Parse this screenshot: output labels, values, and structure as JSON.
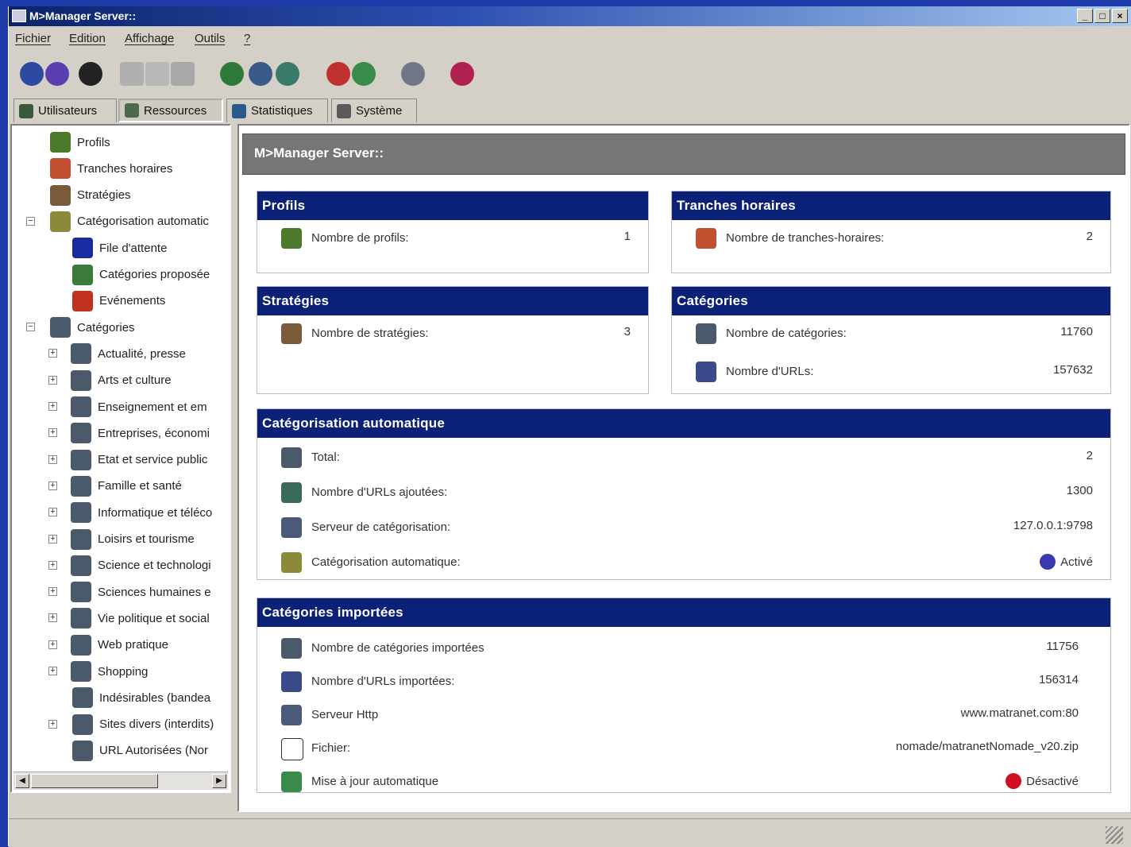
{
  "window": {
    "title": "M>Manager Server::",
    "controls": [
      "_",
      "□",
      "×"
    ]
  },
  "menu": [
    "Fichier",
    "Edition",
    "Affichage",
    "Outils",
    "?"
  ],
  "toolbar": {
    "icons": [
      "new-icon",
      "connect-icon",
      "delete-icon",
      "cut-icon",
      "copy-icon",
      "paste-icon",
      "import-icon",
      "export-icon",
      "refresh-icon",
      "calendar-icon",
      "sync-icon",
      "server-icon",
      "help-book-icon"
    ],
    "colors": [
      "#2b4aa0",
      "#5a3fb0",
      "#222222",
      "#b0b0b0",
      "#b8b8b8",
      "#a8a8a8",
      "#2f7a3a",
      "#3a5a8a",
      "#3a7a6a",
      "#c03030",
      "#3a8a4a",
      "#707888",
      "#b02050"
    ]
  },
  "tabs": [
    "Utilisateurs",
    "Ressources",
    "Statistiques",
    "Système"
  ],
  "tree": [
    {
      "label": "Profils",
      "icon": "user-icon",
      "color": "#4a7a2a"
    },
    {
      "label": "Tranches horaires",
      "icon": "clock-icon",
      "color": "#c05030"
    },
    {
      "label": "Stratégies",
      "icon": "strategy-icon",
      "color": "#7a5a3a"
    },
    {
      "label": "Catégorisation automatic",
      "icon": "gears-icon",
      "color": "#8a8a3a"
    },
    {
      "label": "File d'attente",
      "icon": "question-icon",
      "color": "#1a2aa0"
    },
    {
      "label": "Catégories proposée",
      "icon": "proposal-icon",
      "color": "#3a7a3a"
    },
    {
      "label": "Evénements",
      "icon": "warning-icon",
      "color": "#c03020"
    },
    {
      "label": "Catégories",
      "icon": "folder-stack-icon",
      "color": "#4a5a6a"
    },
    {
      "label": "Actualité, presse",
      "icon": "category-icon",
      "color": "#4a5a6a"
    },
    {
      "label": "Arts et culture",
      "icon": "category-icon",
      "color": "#4a5a6a"
    },
    {
      "label": "Enseignement et em",
      "icon": "category-icon",
      "color": "#4a5a6a"
    },
    {
      "label": "Entreprises, économi",
      "icon": "category-icon",
      "color": "#4a5a6a"
    },
    {
      "label": "Etat et service public",
      "icon": "category-icon",
      "color": "#4a5a6a"
    },
    {
      "label": "Famille et santé",
      "icon": "category-icon",
      "color": "#4a5a6a"
    },
    {
      "label": "Informatique et téléco",
      "icon": "category-icon",
      "color": "#4a5a6a"
    },
    {
      "label": "Loisirs et tourisme",
      "icon": "category-icon",
      "color": "#4a5a6a"
    },
    {
      "label": "Science et technologi",
      "icon": "category-icon",
      "color": "#4a5a6a"
    },
    {
      "label": "Sciences humaines e",
      "icon": "category-icon",
      "color": "#4a5a6a"
    },
    {
      "label": "Vie politique et social",
      "icon": "category-icon",
      "color": "#4a5a6a"
    },
    {
      "label": "Web pratique",
      "icon": "category-icon",
      "color": "#4a5a6a"
    },
    {
      "label": "Shopping",
      "icon": "category-icon",
      "color": "#4a5a6a"
    },
    {
      "label": "Indésirables (bandea",
      "icon": "category-icon",
      "color": "#4a5a6a"
    },
    {
      "label": "Sites divers (interdits)",
      "icon": "category-icon",
      "color": "#4a5a6a"
    },
    {
      "label": "URL Autorisées (Nor",
      "icon": "category-icon",
      "color": "#4a5a6a"
    }
  ],
  "header": {
    "title": "M>Manager Server::"
  },
  "cards": {
    "profils": {
      "title": "Profils",
      "rows": [
        {
          "label": "Nombre de profils:",
          "value": "1",
          "icon": "user-icon",
          "color": "#4a7a2a"
        }
      ]
    },
    "tranches": {
      "title": "Tranches horaires",
      "rows": [
        {
          "label": "Nombre de tranches-horaires:",
          "value": "2",
          "icon": "clock-icon",
          "color": "#c05030"
        }
      ]
    },
    "strategies": {
      "title": "Stratégies",
      "rows": [
        {
          "label": "Nombre de stratégies:",
          "value": "3",
          "icon": "strategy-icon",
          "color": "#7a5a3a"
        }
      ]
    },
    "categories": {
      "title": "Catégories",
      "rows": [
        {
          "label": "Nombre de catégories:",
          "value": "11760",
          "icon": "folder-stack-icon",
          "color": "#4a5a6a"
        },
        {
          "label": "Nombre d'URLs:",
          "value": "157632",
          "icon": "url-search-icon",
          "color": "#3a4a8a"
        }
      ]
    },
    "autocat": {
      "title": "Catégorisation automatique",
      "rows": [
        {
          "label": "Total:",
          "value": "2",
          "icon": "folder-stack-icon",
          "color": "#4a5a6a"
        },
        {
          "label": "Nombre d'URLs ajoutées:",
          "value": "1300",
          "icon": "url-search-icon",
          "color": "#3a6a5a"
        },
        {
          "label": "Serveur de catégorisation:",
          "value": "127.0.0.1:9798",
          "icon": "server-icon",
          "color": "#4a5a7a"
        },
        {
          "label": "Catégorisation automatique:",
          "value": "Activé",
          "icon": "gears-icon",
          "color": "#8a8a3a",
          "status_icon": "active-icon",
          "status_color": "#3a3ab0"
        }
      ]
    },
    "imported": {
      "title": "Catégories importées",
      "rows": [
        {
          "label": "Nombre de catégories importées",
          "value": "11756",
          "icon": "folder-stack-icon",
          "color": "#4a5a6a"
        },
        {
          "label": "Nombre d'URLs importées:",
          "value": "156314",
          "icon": "url-search-icon",
          "color": "#3a4a8a"
        },
        {
          "label": "Serveur Http",
          "value": "www.matranet.com:80",
          "icon": "server-icon",
          "color": "#4a5a7a"
        },
        {
          "label": "Fichier:",
          "value": "nomade/matranetNomade_v20.zip",
          "icon": "file-icon",
          "color": "#ffffff"
        },
        {
          "label": "Mise à jour automatique",
          "value": "Désactivé",
          "icon": "update-icon",
          "color": "#3a8a4a",
          "status_icon": "disabled-icon",
          "status_color": "#d01020"
        }
      ]
    }
  }
}
